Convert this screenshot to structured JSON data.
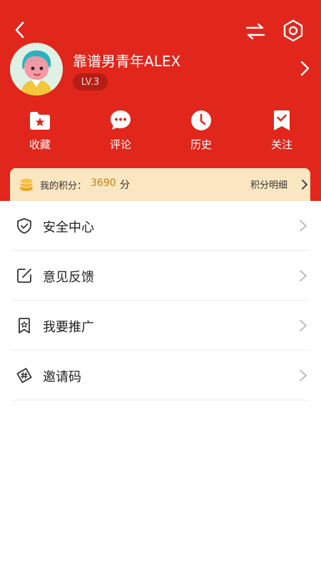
{
  "header": {
    "back_icon": "chevron-left-icon",
    "switch_icon": "swap-arrows-icon",
    "settings_icon": "hexagon-settings-icon",
    "background_color": "#e1261c"
  },
  "profile": {
    "username": "靠谱男青年ALEX",
    "level": "LV.3",
    "avatar_icon": "cartoon-avatar-icon"
  },
  "quick_actions": [
    {
      "label": "收藏",
      "icon": "folder-star-icon"
    },
    {
      "label": "评论",
      "icon": "chat-bubble-icon"
    },
    {
      "label": "历史",
      "icon": "clock-icon"
    },
    {
      "label": "关注",
      "icon": "bookmark-check-icon"
    }
  ],
  "points": {
    "label": "我的积分：",
    "value": "3690",
    "unit": "分",
    "detail_link": "积分明细",
    "accent_color": "#c47f14"
  },
  "menu": [
    {
      "label": "安全中心",
      "icon": "shield-check-icon"
    },
    {
      "label": "意见反馈",
      "icon": "edit-square-icon"
    },
    {
      "label": "我要推广",
      "icon": "bookmark-star-icon"
    },
    {
      "label": "邀请码",
      "icon": "hash-tag-icon"
    }
  ]
}
